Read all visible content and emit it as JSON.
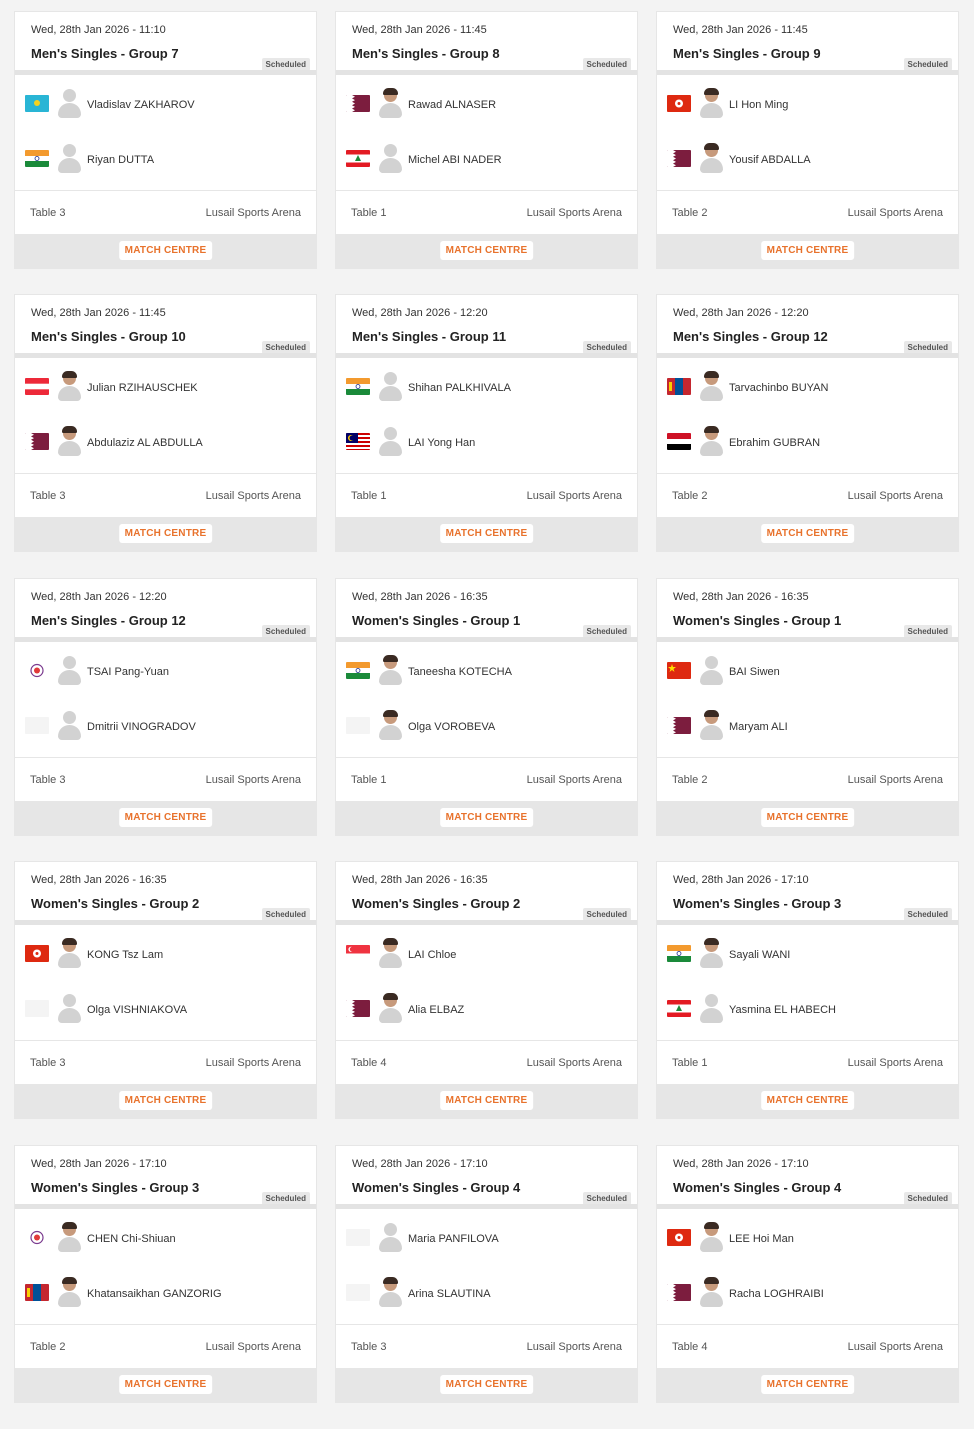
{
  "scheduled_label": "Scheduled",
  "match_centre_label": "MATCH CENTRE",
  "cards": [
    {
      "date": "Wed, 28th Jan 2026 - 11:10",
      "title": "Men's Singles - Group 7",
      "table": "Table 3",
      "venue": "Lusail Sports Arena",
      "p1": {
        "name": "Vladislav ZAKHAROV",
        "flag": "kazakhstan",
        "photo": false
      },
      "p2": {
        "name": "Riyan DUTTA",
        "flag": "india",
        "photo": false
      }
    },
    {
      "date": "Wed, 28th Jan 2026 - 11:45",
      "title": "Men's Singles - Group 8",
      "table": "Table 1",
      "venue": "Lusail Sports Arena",
      "p1": {
        "name": "Rawad ALNASER",
        "flag": "qatar",
        "photo": true
      },
      "p2": {
        "name": "Michel ABI NADER",
        "flag": "lebanon",
        "photo": false
      }
    },
    {
      "date": "Wed, 28th Jan 2026 - 11:45",
      "title": "Men's Singles - Group 9",
      "table": "Table 2",
      "venue": "Lusail Sports Arena",
      "p1": {
        "name": "LI Hon Ming",
        "flag": "hongkong",
        "photo": true
      },
      "p2": {
        "name": "Yousif ABDALLA",
        "flag": "qatar",
        "photo": true
      }
    },
    {
      "date": "Wed, 28th Jan 2026 - 11:45",
      "title": "Men's Singles - Group 10",
      "table": "Table 3",
      "venue": "Lusail Sports Arena",
      "p1": {
        "name": "Julian RZIHAUSCHEK",
        "flag": "austria",
        "photo": true
      },
      "p2": {
        "name": "Abdulaziz AL ABDULLA",
        "flag": "qatar",
        "photo": true
      }
    },
    {
      "date": "Wed, 28th Jan 2026 - 12:20",
      "title": "Men's Singles - Group 11",
      "table": "Table 1",
      "venue": "Lusail Sports Arena",
      "p1": {
        "name": "Shihan PALKHIVALA",
        "flag": "india",
        "photo": false
      },
      "p2": {
        "name": "LAI Yong Han",
        "flag": "malaysia",
        "photo": false
      }
    },
    {
      "date": "Wed, 28th Jan 2026 - 12:20",
      "title": "Men's Singles - Group 12",
      "table": "Table 2",
      "venue": "Lusail Sports Arena",
      "p1": {
        "name": "Tarvachinbo BUYAN",
        "flag": "mongolia",
        "photo": true
      },
      "p2": {
        "name": "Ebrahim GUBRAN",
        "flag": "yemen",
        "photo": true
      }
    },
    {
      "date": "Wed, 28th Jan 2026 - 12:20",
      "title": "Men's Singles - Group 12",
      "table": "Table 3",
      "venue": "Lusail Sports Arena",
      "p1": {
        "name": "TSAI Pang-Yuan",
        "flag": "tpe",
        "photo": false
      },
      "p2": {
        "name": "Dmitrii VINOGRADOV",
        "flag": "blank",
        "photo": false
      }
    },
    {
      "date": "Wed, 28th Jan 2026 - 16:35",
      "title": "Women's Singles - Group 1",
      "table": "Table 1",
      "venue": "Lusail Sports Arena",
      "p1": {
        "name": "Taneesha KOTECHA",
        "flag": "india",
        "photo": true
      },
      "p2": {
        "name": "Olga VOROBEVA",
        "flag": "blank",
        "photo": true
      }
    },
    {
      "date": "Wed, 28th Jan 2026 - 16:35",
      "title": "Women's Singles - Group 1",
      "table": "Table 2",
      "venue": "Lusail Sports Arena",
      "p1": {
        "name": "BAI Siwen",
        "flag": "china",
        "photo": false
      },
      "p2": {
        "name": "Maryam ALI",
        "flag": "qatar",
        "photo": true
      }
    },
    {
      "date": "Wed, 28th Jan 2026 - 16:35",
      "title": "Women's Singles - Group 2",
      "table": "Table 3",
      "venue": "Lusail Sports Arena",
      "p1": {
        "name": "KONG Tsz Lam",
        "flag": "hongkong",
        "photo": true
      },
      "p2": {
        "name": "Olga VISHNIAKOVA",
        "flag": "blank",
        "photo": false
      }
    },
    {
      "date": "Wed, 28th Jan 2026 - 16:35",
      "title": "Women's Singles - Group 2",
      "table": "Table 4",
      "venue": "Lusail Sports Arena",
      "p1": {
        "name": "LAI Chloe",
        "flag": "singapore",
        "photo": true
      },
      "p2": {
        "name": "Alia ELBAZ",
        "flag": "qatar",
        "photo": true
      }
    },
    {
      "date": "Wed, 28th Jan 2026 - 17:10",
      "title": "Women's Singles - Group 3",
      "table": "Table 1",
      "venue": "Lusail Sports Arena",
      "p1": {
        "name": "Sayali WANI",
        "flag": "india",
        "photo": true
      },
      "p2": {
        "name": "Yasmina EL HABECH",
        "flag": "lebanon",
        "photo": false
      }
    },
    {
      "date": "Wed, 28th Jan 2026 - 17:10",
      "title": "Women's Singles - Group 3",
      "table": "Table 2",
      "venue": "Lusail Sports Arena",
      "p1": {
        "name": "CHEN Chi-Shiuan",
        "flag": "tpe",
        "photo": true
      },
      "p2": {
        "name": "Khatansaikhan GANZORIG",
        "flag": "mongolia",
        "photo": true
      }
    },
    {
      "date": "Wed, 28th Jan 2026 - 17:10",
      "title": "Women's Singles - Group 4",
      "table": "Table 3",
      "venue": "Lusail Sports Arena",
      "p1": {
        "name": "Maria PANFILOVA",
        "flag": "blank",
        "photo": false
      },
      "p2": {
        "name": "Arina SLAUTINA",
        "flag": "blank",
        "photo": true
      }
    },
    {
      "date": "Wed, 28th Jan 2026 - 17:10",
      "title": "Women's Singles - Group 4",
      "table": "Table 4",
      "venue": "Lusail Sports Arena",
      "p1": {
        "name": "LEE Hoi Man",
        "flag": "hongkong",
        "photo": true
      },
      "p2": {
        "name": "Racha LOGHRAIBI",
        "flag": "qatar",
        "photo": true
      }
    }
  ]
}
